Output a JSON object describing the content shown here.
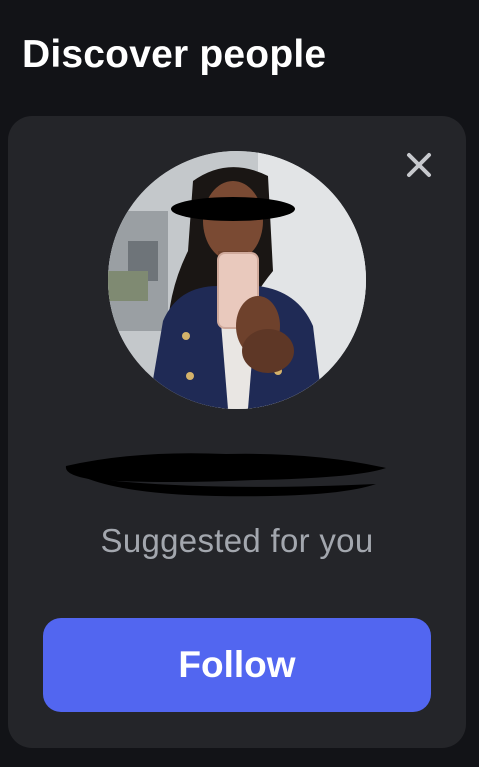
{
  "header": {
    "title": "Discover people"
  },
  "suggestion_card": {
    "dismiss_icon": "close-icon",
    "avatar_icon": "profile-photo",
    "subtitle": "Suggested for you",
    "follow_label": "Follow"
  },
  "colors": {
    "background": "#121317",
    "card": "#242529",
    "accent": "#5266f0",
    "muted_text": "#a3a7ae"
  }
}
